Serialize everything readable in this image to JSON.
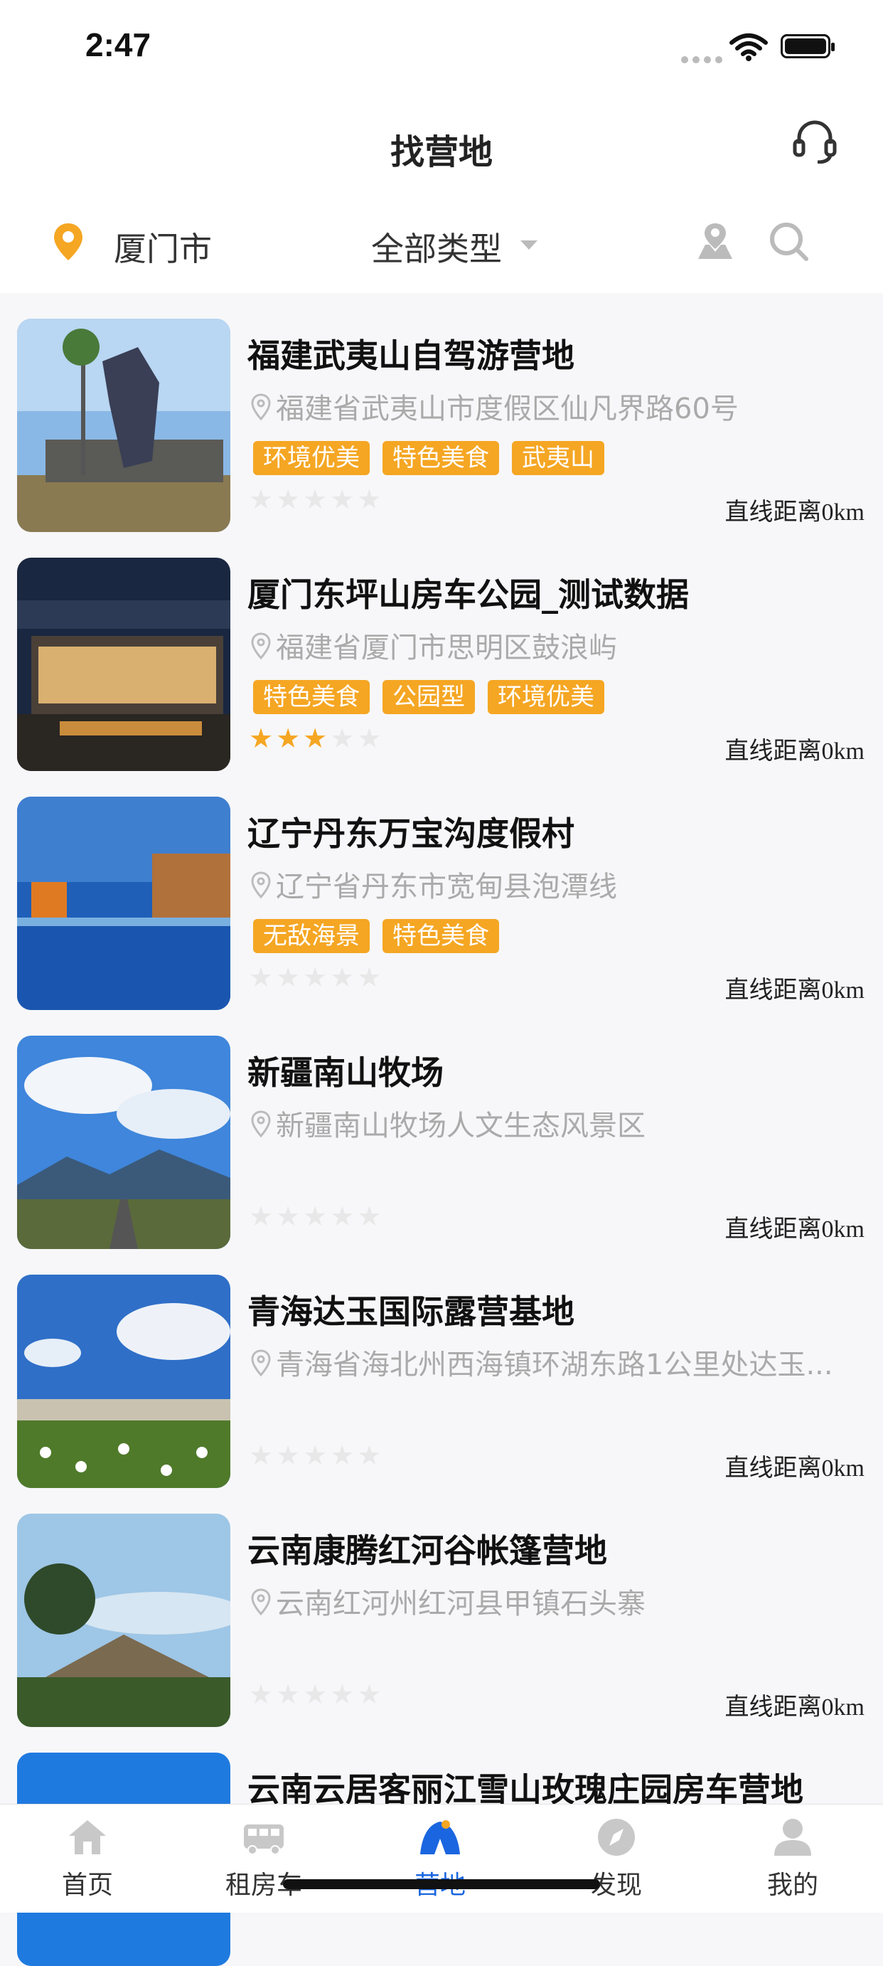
{
  "status_bar": {
    "time": "2:47"
  },
  "header": {
    "title": "找营地",
    "service_icon": "headset-icon"
  },
  "filter": {
    "city": "厦门市",
    "type": "全部类型",
    "icons": [
      "location-pin-icon",
      "map-pin-icon",
      "search-icon"
    ]
  },
  "camps": [
    {
      "name": "福建武夷山自驾游营地",
      "address": "福建省武夷山市度假区仙凡界路60号",
      "tags": [
        "环境优美",
        "特色美食",
        "武夷山"
      ],
      "rating": 0,
      "distance": "直线距离0km"
    },
    {
      "name": "厦门东坪山房车公园_测试数据",
      "address": "福建省厦门市思明区鼓浪屿",
      "tags": [
        "特色美食",
        "公园型",
        "环境优美"
      ],
      "rating": 3,
      "distance": "直线距离0km"
    },
    {
      "name": "辽宁丹东万宝沟度假村",
      "address": "辽宁省丹东市宽甸县泡潭线",
      "tags": [
        "无敌海景",
        "特色美食"
      ],
      "rating": 0,
      "distance": "直线距离0km"
    },
    {
      "name": "新疆南山牧场",
      "address": "新疆南山牧场人文生态风景区",
      "tags": [],
      "rating": 0,
      "distance": "直线距离0km"
    },
    {
      "name": "青海达玉国际露营基地",
      "address": "青海省海北州西海镇环湖东路1公里处达玉...",
      "tags": [],
      "rating": 0,
      "distance": "直线距离0km"
    },
    {
      "name": "云南康腾红河谷帐篷营地",
      "address": "云南红河州红河县甲镇石头寨",
      "tags": [],
      "rating": 0,
      "distance": "直线距离0km"
    },
    {
      "name": "云南云居客丽江雪山玫瑰庄园房车营地",
      "address": "",
      "tags": [],
      "rating": 0,
      "distance": ""
    }
  ],
  "tabbar": {
    "items": [
      {
        "label": "首页",
        "icon": "home-icon"
      },
      {
        "label": "租房车",
        "icon": "rv-icon"
      },
      {
        "label": "营地",
        "icon": "tent-icon"
      },
      {
        "label": "发现",
        "icon": "compass-icon"
      },
      {
        "label": "我的",
        "icon": "user-icon"
      }
    ],
    "active": "营地",
    "active_color": "#1a66e0"
  },
  "colors": {
    "tag_bg": "#f5a623",
    "star_on": "#f5a623",
    "star_off": "#e8e8e8",
    "address": "#aaaaaa"
  }
}
